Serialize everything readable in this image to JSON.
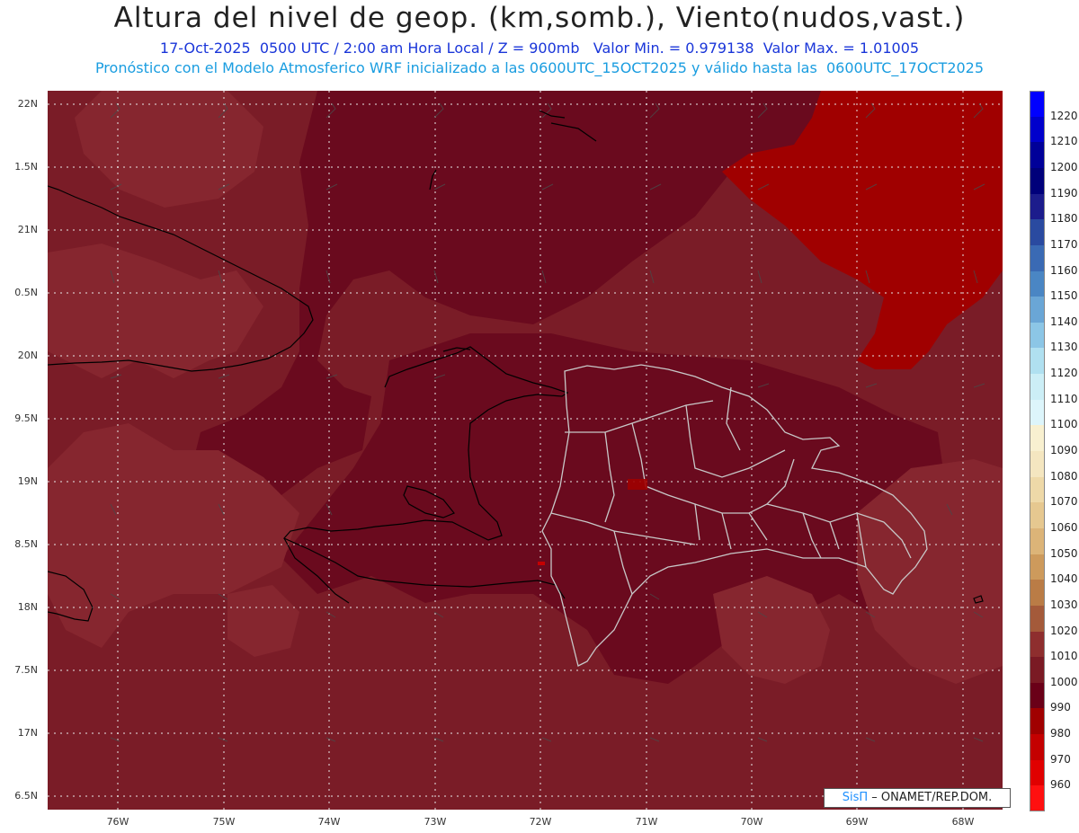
{
  "title": "Altura del nivel de geop. (km,somb.), Viento(nudos,vast.)",
  "subtitle_line1": "17-Oct-2025  0500 UTC / 2:00 am Hora Local / Z = 900mb   Valor Min. = 0.979138  Valor Max. = 1.01005",
  "subtitle_line2": "Pronóstico con el Modelo Atmosferico WRF inicializado a las 0600UTC_15OCT2025 y válido hasta las  0600UTC_17OCT2025",
  "latitude_labels": [
    "22N",
    "1.5N",
    "21N",
    "0.5N",
    "20N",
    "9.5N",
    "19N",
    "8.5N",
    "18N",
    "7.5N",
    "17N",
    "6.5N"
  ],
  "longitude_labels": [
    "76W",
    "75W",
    "74W",
    "73W",
    "72W",
    "71W",
    "70W",
    "69W",
    "68W"
  ],
  "colorbar": {
    "levels": [
      "1220",
      "1210",
      "1200",
      "1190",
      "1180",
      "1170",
      "1160",
      "1150",
      "1140",
      "1130",
      "1120",
      "1110",
      "1100",
      "1090",
      "1080",
      "1070",
      "1060",
      "1050",
      "1040",
      "1030",
      "1020",
      "1010",
      "1000",
      "990",
      "980",
      "970",
      "960"
    ],
    "colors": [
      "#0000ff",
      "#0000cc",
      "#000099",
      "#00007a",
      "#1c1c8c",
      "#2a4aa0",
      "#3a6ab4",
      "#4a86c4",
      "#6aa6d6",
      "#8cc6e6",
      "#b0e0f0",
      "#cceef6",
      "#ddf5fb",
      "#f8f0d0",
      "#f4e6c0",
      "#eed9a8",
      "#e6c890",
      "#dcb478",
      "#cd9a5c",
      "#ba7c46",
      "#a45a3a",
      "#8e2e2e",
      "#7a1a24",
      "#6a0018",
      "#a00000",
      "#c40000",
      "#e00000",
      "#ff1010"
    ]
  },
  "map_colors": {
    "base": "#7a1c27",
    "dark": "#6a0a1e",
    "lighter": "#86262f",
    "max_area": "#a00000",
    "coast": "#000000",
    "provinces": "#c8c8c8"
  },
  "credit": {
    "logo": "SisΠ",
    "text": "– ONAMET/REP.DOM."
  }
}
